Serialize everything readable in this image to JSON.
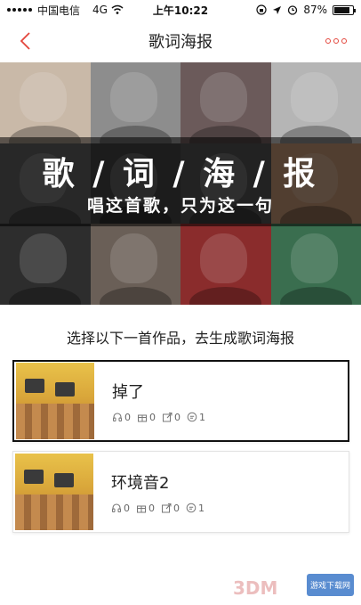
{
  "status_bar": {
    "carrier": "中国电信",
    "network": "4G",
    "time": "上午10:22",
    "battery": "87%",
    "battery_level": 0.87
  },
  "nav": {
    "title": "歌词海报",
    "back_icon": "chevron-left-icon",
    "more_icon": "more-dots-icon",
    "accent_color": "#e3463c"
  },
  "banner": {
    "heading": "歌 / 词 / 海 / 报",
    "subtitle": "唱这首歌，只为这一句",
    "tile_colors": [
      "#c9b9a8",
      "#8d8d8d",
      "#6b5a5a",
      "#b5b5b5",
      "#5a5a5a",
      "#3e3e3e",
      "#4d4d4d",
      "#b38a6b",
      "#2d2d2d",
      "#6a5f57",
      "#8a2c2c",
      "#3a6e4f"
    ]
  },
  "instruction": "选择以下一首作品，去生成歌词海报",
  "songs": [
    {
      "title": "掉了",
      "stats": {
        "listen": "0",
        "gift": "0",
        "share": "0",
        "comment": "1"
      },
      "selected": true
    },
    {
      "title": "环境音2",
      "stats": {
        "listen": "0",
        "gift": "0",
        "share": "0",
        "comment": "1"
      },
      "selected": false
    }
  ],
  "watermark": {
    "text": "3DM",
    "badge": "游戏下载网"
  }
}
